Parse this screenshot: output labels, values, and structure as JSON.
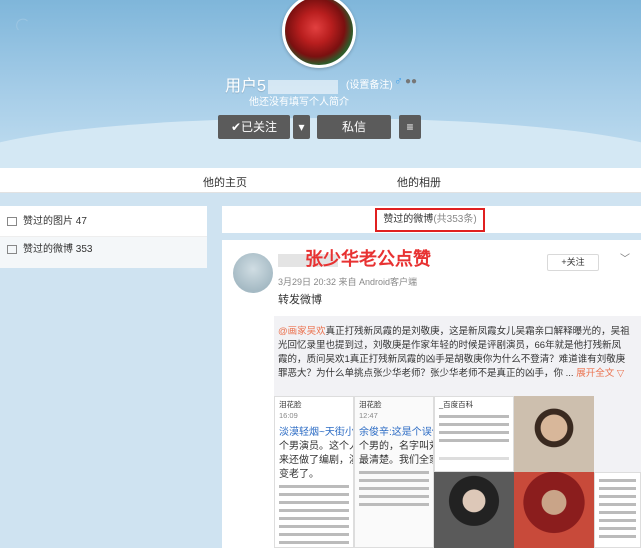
{
  "header": {
    "username": "用户5",
    "remark": "(设置备注)",
    "gender_icon": "♂",
    "intro": "他还没有填写个人简介",
    "follow_label": "✔已关注",
    "dropdown_icon": "▾",
    "message_label": "私信",
    "more_icon": "≡"
  },
  "nav": {
    "home": "他的主页",
    "album": "他的相册"
  },
  "sidebar": {
    "items": [
      {
        "label": "赞过的图片",
        "count": "47"
      },
      {
        "label": "赞过的微博",
        "count": "353"
      }
    ]
  },
  "tab": {
    "label": "赞过的微博",
    "count": "(共353条)"
  },
  "post": {
    "annotation": "张少华老公点赞",
    "time": "3月29日 20:32 来自 Android客户端",
    "label": "转发微博",
    "follow_label": "+关注",
    "repost": {
      "at": "@画家吴欢",
      "text": "真正打残新凤霞的是刘敬庚，这是新凤霞女儿吴霜亲口解释曝光的，吴祖光回忆录里也提到过，刘敬庚是作家年轻的时候是评剧演员，66年就是他打残新凤霞的，质问吴欢1真正打残新凤霞的凶手是胡敬庚你为什么不登清？难道谁有刘敬庚罪恶大？为什么单挑点张少华老师？张少华老师不是真正的凶手，你 ...",
      "more": "展开全文 ▽"
    },
    "thumbs": {
      "t1_line1": "泪花脸",
      "t1_line2": "16:09",
      "t1_line3": "淡漠轻烟~天街小雨",
      "t1_line4": "个男演员。这个人",
      "t1_line5": "来还做了编剧，演",
      "t1_line6": "变老了。",
      "t2_line1": "泪花脸",
      "t2_line2": "12:47",
      "t2_line3": "余俊辛:这是个误传",
      "t2_line4": "个男的，名字叫刘",
      "t2_line5": "最清楚。我们全家",
      "t3_line1": "_百度百科"
    }
  }
}
